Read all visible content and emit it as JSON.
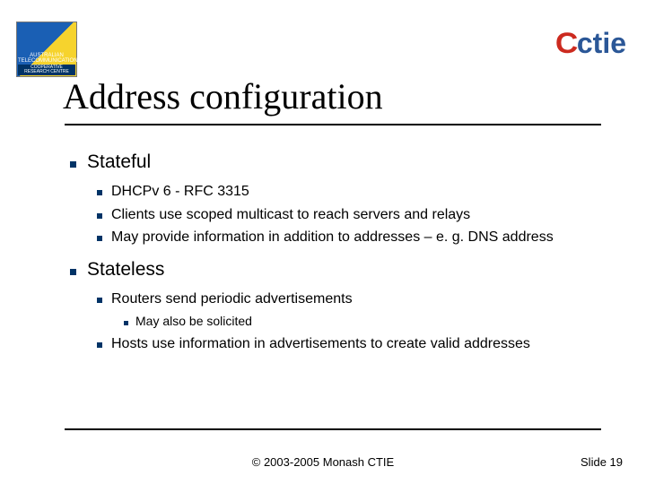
{
  "logo_left": {
    "line1": "AUSTRALIAN",
    "line2": "TELECOMMUNICATIONS",
    "line3": "COOPERATIVE RESEARCH CENTRE"
  },
  "logo_right": {
    "brand": "ctie",
    "accent_letter": "C"
  },
  "title": "Address configuration",
  "bullets": {
    "stateful": {
      "label": "Stateful",
      "items": [
        "DHCPv 6 - RFC 3315",
        "Clients use scoped multicast to reach servers and relays",
        "May provide information in addition to addresses – e. g. DNS address"
      ]
    },
    "stateless": {
      "label": "Stateless",
      "routers": {
        "label": "Routers send periodic advertisements",
        "sub": "May also be solicited"
      },
      "hosts": "Hosts use information in advertisements to create valid addresses"
    }
  },
  "footer": {
    "center": "© 2003-2005 Monash CTIE",
    "right": "Slide 19"
  }
}
